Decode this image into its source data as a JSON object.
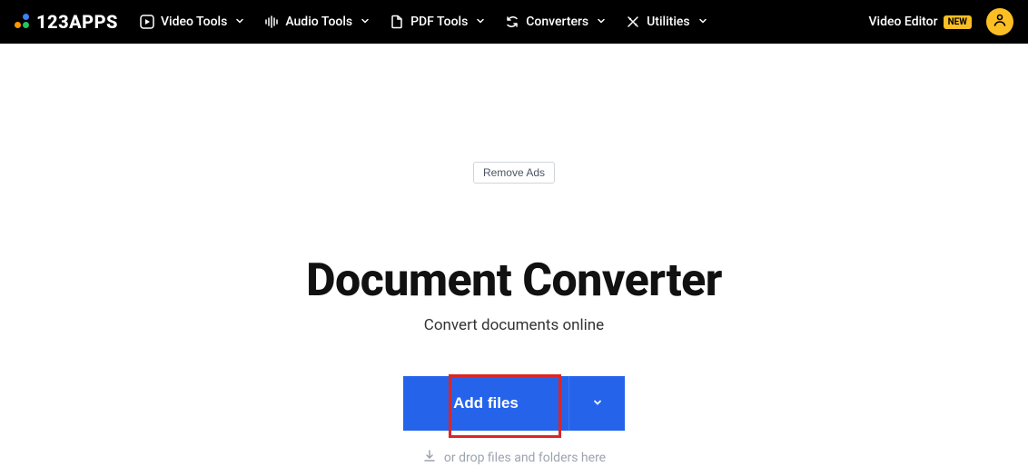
{
  "header": {
    "logo_text": "123APPS",
    "nav": [
      {
        "label": "Video Tools"
      },
      {
        "label": "Audio Tools"
      },
      {
        "label": "PDF Tools"
      },
      {
        "label": "Converters"
      },
      {
        "label": "Utilities"
      }
    ],
    "video_editor_label": "Video Editor",
    "new_badge": "NEW"
  },
  "main": {
    "remove_ads": "Remove Ads",
    "title": "Document Converter",
    "subtitle": "Convert documents online",
    "add_files": "Add files",
    "drop_hint": "or drop files and folders here"
  }
}
